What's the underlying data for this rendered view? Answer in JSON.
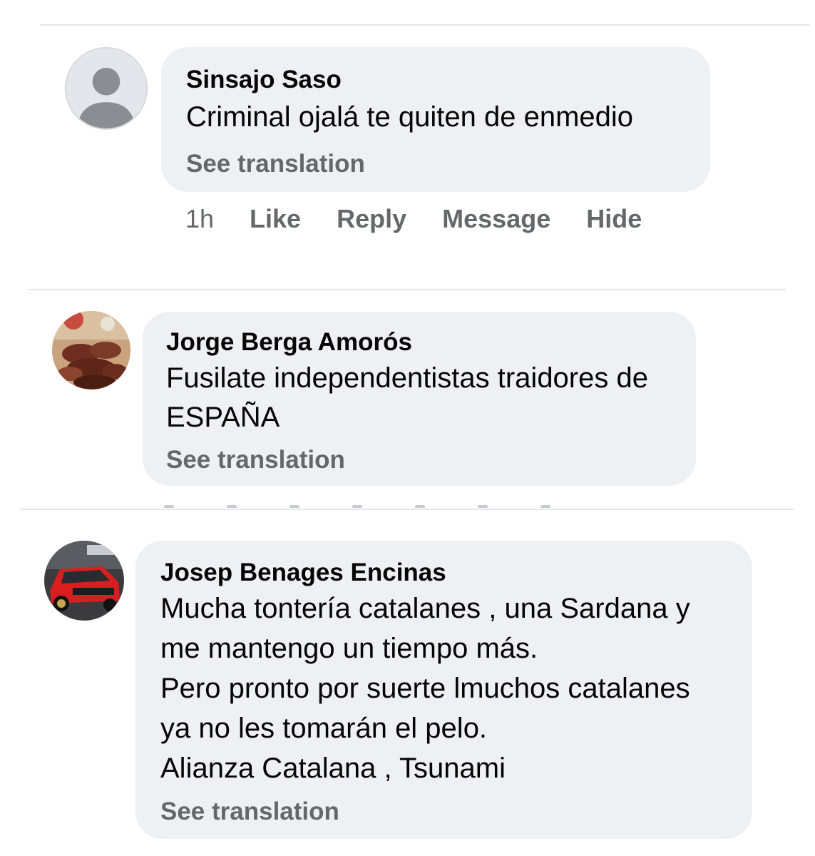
{
  "comments": [
    {
      "author": "Sinsajo Saso",
      "lines": [
        "Criminal ojalá te quiten de enmedio"
      ],
      "see_translation": "See translation",
      "avatar": "default-avatar-icon",
      "meta": {
        "time": "1h",
        "like": "Like",
        "reply": "Reply",
        "message": "Message",
        "hide": "Hide"
      }
    },
    {
      "author": "Jorge Berga Amorós",
      "lines": [
        "Fusilate independentistas traidores de",
        "ESPAÑA"
      ],
      "see_translation": "See translation",
      "avatar": "photo-avatar"
    },
    {
      "author": "Josep Benages Encinas",
      "lines": [
        "Mucha tontería catalanes , una Sardana y",
        "me mantengo un tiempo más.",
        "Pero pronto por suerte lmuchos catalanes",
        "ya no les tomarán el pelo.",
        "Alianza Catalana , Tsunami"
      ],
      "see_translation": "See translation",
      "avatar": "red-car-photo-avatar"
    }
  ],
  "colors": {
    "bubble": "#eff0f4",
    "secondary_text": "#65676b",
    "primary_text": "#050505",
    "divider": "#e4e6eb"
  }
}
